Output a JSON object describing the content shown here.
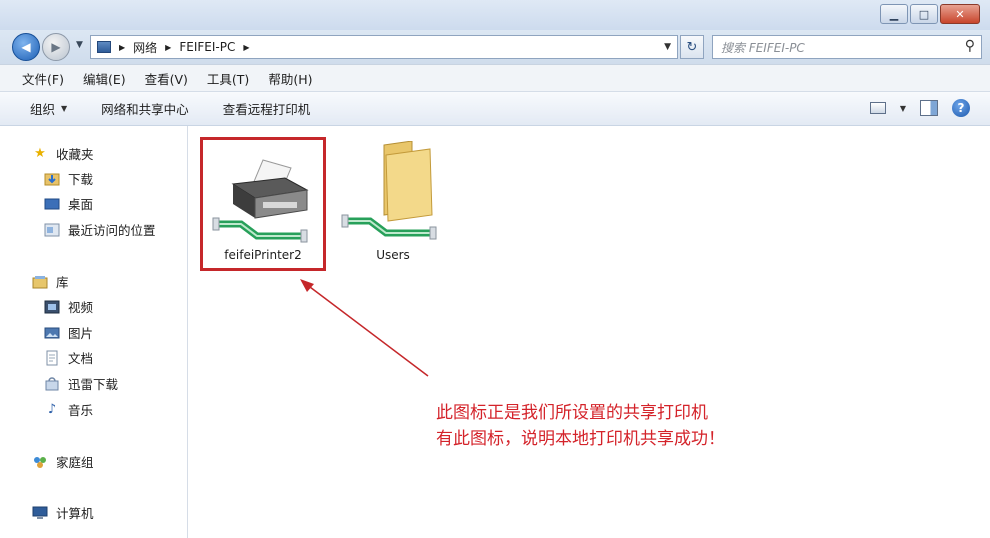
{
  "window": {
    "controls": [
      "minimize",
      "maximize",
      "close"
    ]
  },
  "address": {
    "path": [
      "网络",
      "FEIFEI-PC"
    ],
    "search_placeholder": "搜索 FEIFEI-PC"
  },
  "menu": [
    "文件(F)",
    "编辑(E)",
    "查看(V)",
    "工具(T)",
    "帮助(H)"
  ],
  "commands": {
    "organize": "组织",
    "network_center": "网络和共享中心",
    "remote_printers": "查看远程打印机"
  },
  "nav": {
    "favorites": "收藏夹",
    "downloads": "下载",
    "desktop": "桌面",
    "recent": "最近访问的位置",
    "libraries": "库",
    "videos": "视频",
    "pictures": "图片",
    "documents": "文档",
    "thunder": "迅雷下载",
    "music": "音乐",
    "homegroup": "家庭组",
    "computer": "计算机"
  },
  "items": {
    "printer": "feifeiPrinter2",
    "folder": "Users"
  },
  "annotation": {
    "line1": "此图标正是我们所设置的共享打印机",
    "line2": "有此图标，说明本地打印机共享成功！"
  },
  "colors": {
    "highlight": "#c5272a",
    "annotation": "#d4232a"
  }
}
